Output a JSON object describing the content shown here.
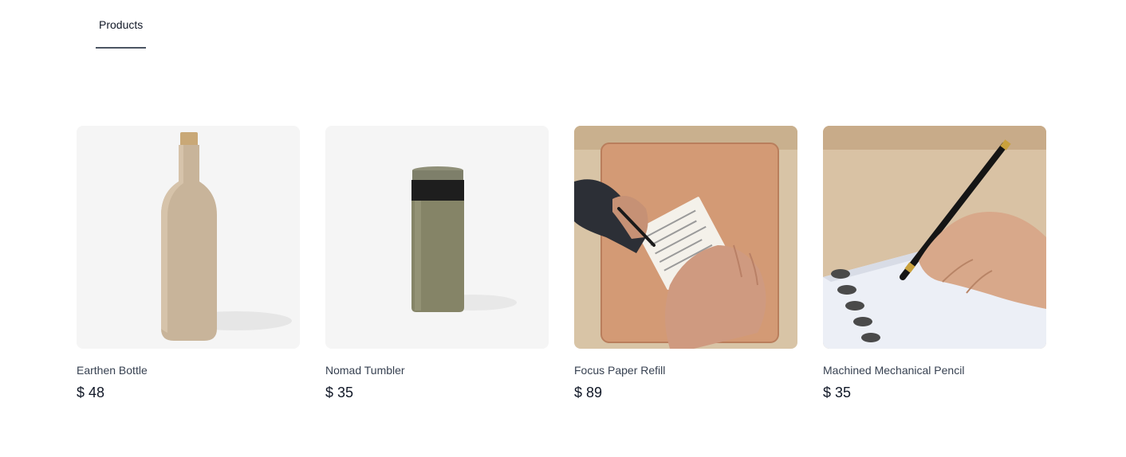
{
  "tabs": [
    {
      "label": "Products",
      "active": true
    }
  ],
  "products": [
    {
      "name": "Earthen Bottle",
      "price": "$ 48",
      "image_icon": "bottle-image"
    },
    {
      "name": "Nomad Tumbler",
      "price": "$ 35",
      "image_icon": "tumbler-image"
    },
    {
      "name": "Focus Paper Refill",
      "price": "$ 89",
      "image_icon": "paper-refill-image"
    },
    {
      "name": "Machined Mechanical Pencil",
      "price": "$ 35",
      "image_icon": "pencil-image"
    }
  ]
}
